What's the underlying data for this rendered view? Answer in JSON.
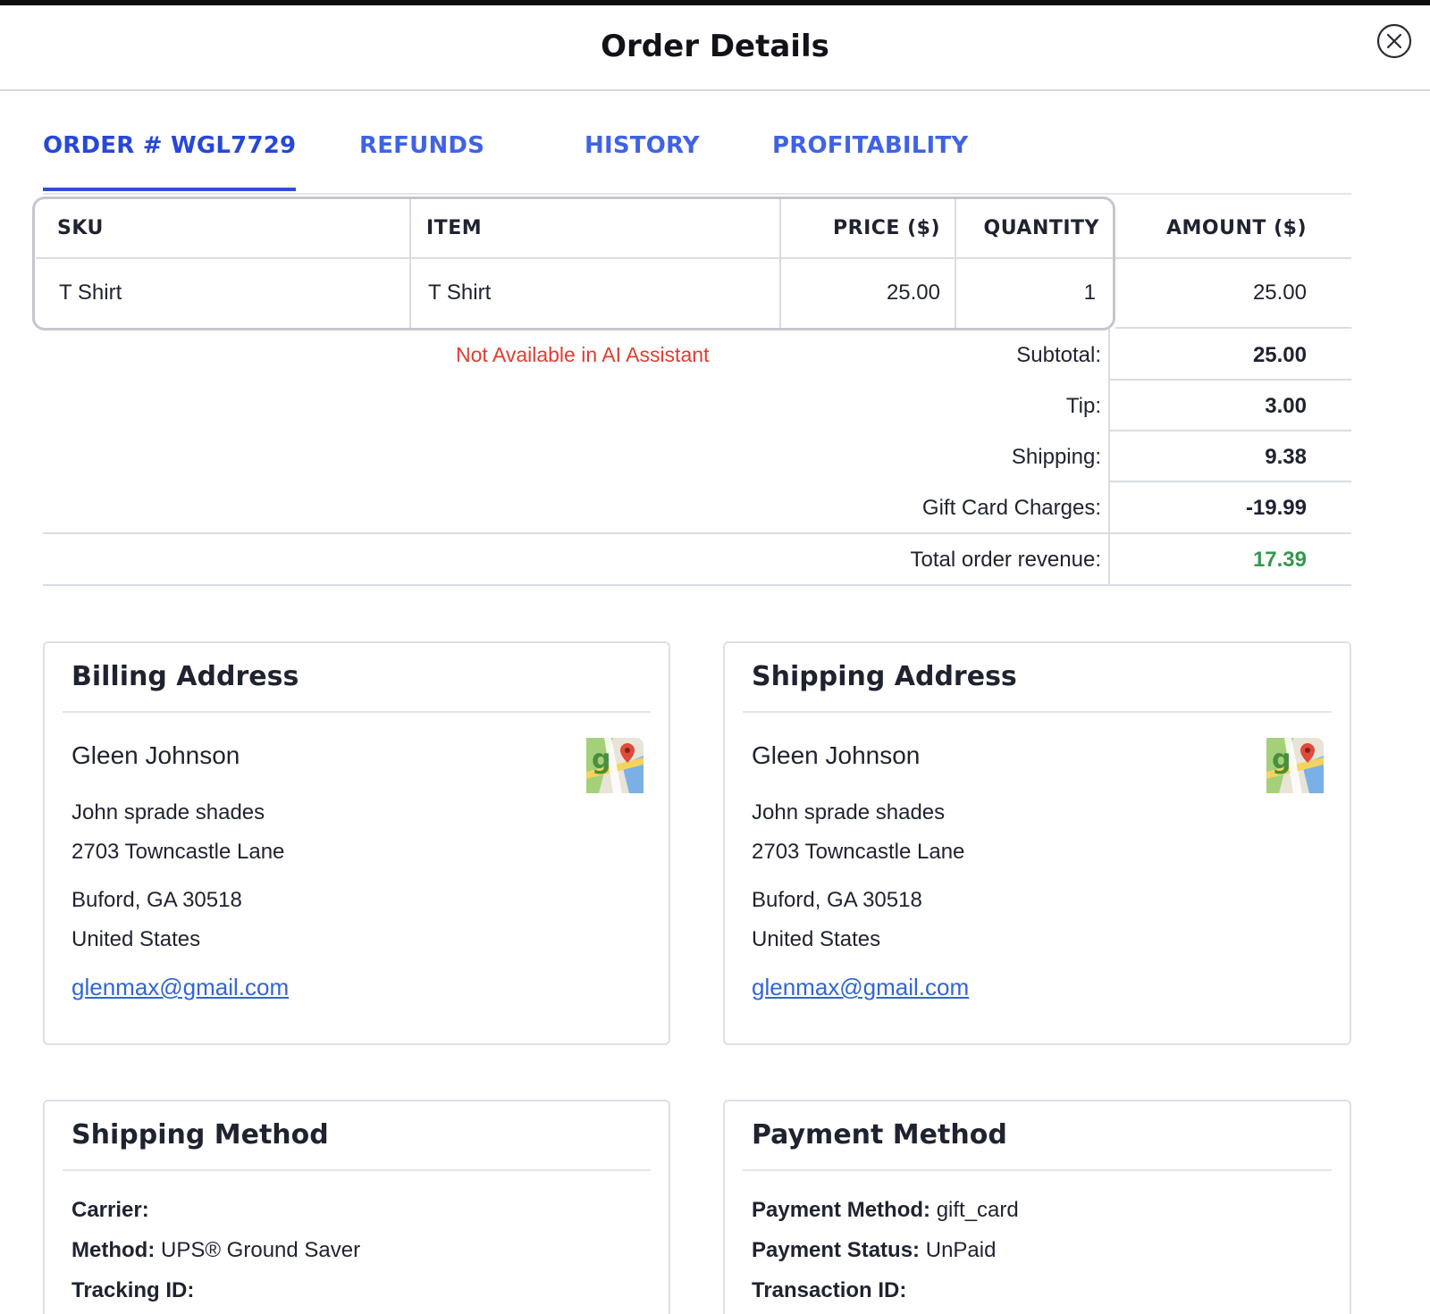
{
  "header": {
    "title": "Order Details",
    "close_icon": "close-circle-icon"
  },
  "tabs": [
    {
      "label": "ORDER # WGL7729",
      "active": true
    },
    {
      "label": "REFUNDS",
      "active": false
    },
    {
      "label": "HISTORY",
      "active": false
    },
    {
      "label": "PROFITABILITY",
      "active": false
    }
  ],
  "items_table": {
    "columns": [
      "SKU",
      "ITEM",
      "PRICE ($)",
      "QUANTITY",
      "AMOUNT ($)"
    ],
    "rows": [
      {
        "sku": "T Shirt",
        "item": "T Shirt",
        "price": "25.00",
        "quantity": "1",
        "amount": "25.00"
      }
    ]
  },
  "notice": "Not Available in AI Assistant",
  "summary": {
    "subtotal_label": "Subtotal:",
    "subtotal": "25.00",
    "tip_label": "Tip:",
    "tip": "3.00",
    "shipping_label": "Shipping:",
    "shipping": "9.38",
    "gift_label": "Gift Card Charges:",
    "gift": "-19.99",
    "total_label": "Total order revenue:",
    "total": "17.39",
    "total_color": "#37964f"
  },
  "billing": {
    "title": "Billing Address",
    "name": "Gleen Johnson",
    "company": "John sprade shades",
    "street": "2703 Towncastle Lane",
    "city": "Buford, GA 30518",
    "country": "United States",
    "email": "glenmax@gmail.com",
    "map_icon": "google-maps-icon"
  },
  "shipping_address": {
    "title": "Shipping Address",
    "name": "Gleen Johnson",
    "company": "John sprade shades",
    "street": "2703 Towncastle Lane",
    "city": "Buford, GA 30518",
    "country": "United States",
    "email": "glenmax@gmail.com",
    "map_icon": "google-maps-icon"
  },
  "shipping_method": {
    "title": "Shipping Method",
    "carrier_label": "Carrier:",
    "carrier": "",
    "method_label": "Method:",
    "method": "UPS® Ground Saver",
    "tracking_label": "Tracking ID:",
    "tracking": ""
  },
  "payment_method": {
    "title": "Payment Method",
    "method_label": "Payment Method:",
    "method": "gift_card",
    "status_label": "Payment Status:",
    "status": "UnPaid",
    "transaction_label": "Transaction ID:",
    "transaction": ""
  },
  "colors": {
    "accent": "#2f4fd9",
    "tab_text": "#3f63e6",
    "notice": "#e03e2f",
    "link": "#3166d6"
  }
}
